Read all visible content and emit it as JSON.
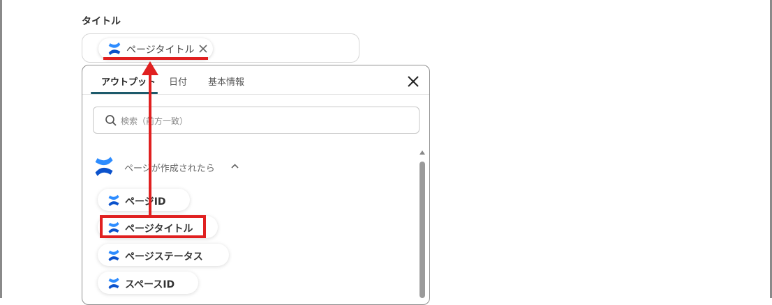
{
  "field": {
    "label": "タイトル"
  },
  "title_input": {
    "token_label": "ページタイトル"
  },
  "panel": {
    "tabs": [
      {
        "label": "アウトプット",
        "active": true
      },
      {
        "label": "日付",
        "active": false
      },
      {
        "label": "基本情報",
        "active": false
      }
    ],
    "search_placeholder": "検索（前方一致）",
    "group": {
      "label": "ページが作成されたら",
      "expanded": true
    },
    "items": [
      {
        "label": "ページID"
      },
      {
        "label": "ページタイトル",
        "highlighted": true
      },
      {
        "label": "ページステータス"
      },
      {
        "label": "スペースID"
      }
    ]
  },
  "colors": {
    "annotation_red": "#e02020",
    "tab_underline": "#1d5a6b",
    "confluence_blue_light": "#2d8cff",
    "confluence_blue_dark": "#0b52cc"
  },
  "icons": {
    "token": "confluence-icon",
    "remove": "close-icon",
    "panel_close": "close-icon",
    "search": "search-icon",
    "group": "confluence-icon",
    "collapse": "chevron-up-icon"
  }
}
